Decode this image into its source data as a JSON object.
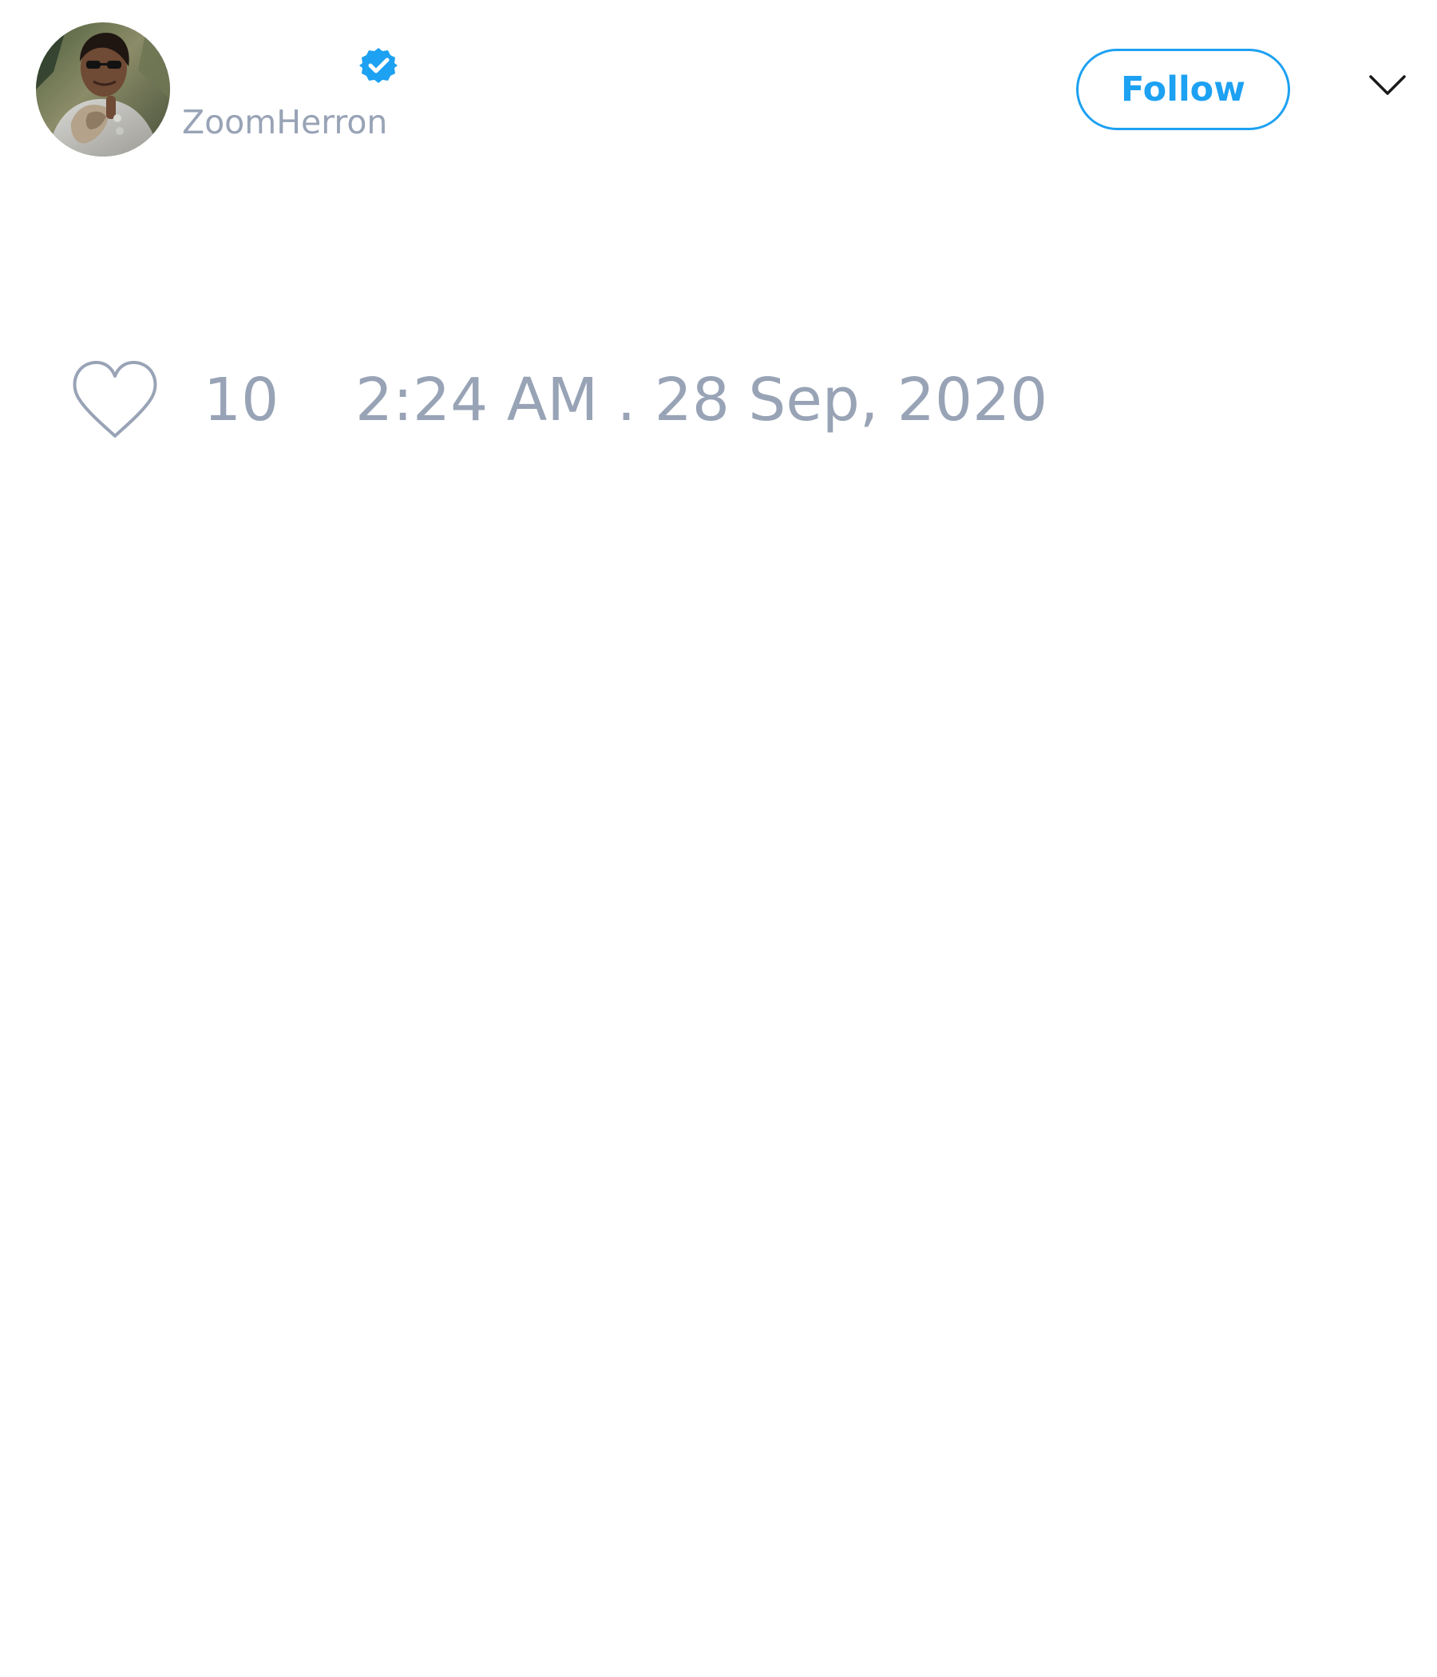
{
  "tweet": {
    "author": {
      "display_name": "",
      "username": "ZoomHerron",
      "verified": true,
      "avatar_icon": "profile-photo"
    },
    "follow_label": "Follow",
    "menu_icon": "chevron-down-icon",
    "like_icon": "heart-icon",
    "like_count": "10",
    "timestamp": "2:24 AM . 28 Sep, 2020"
  },
  "colors": {
    "accent": "#1da1f2",
    "muted_text": "#98a3b6",
    "icon_stroke": "#98a3b6",
    "background": "#ffffff"
  }
}
